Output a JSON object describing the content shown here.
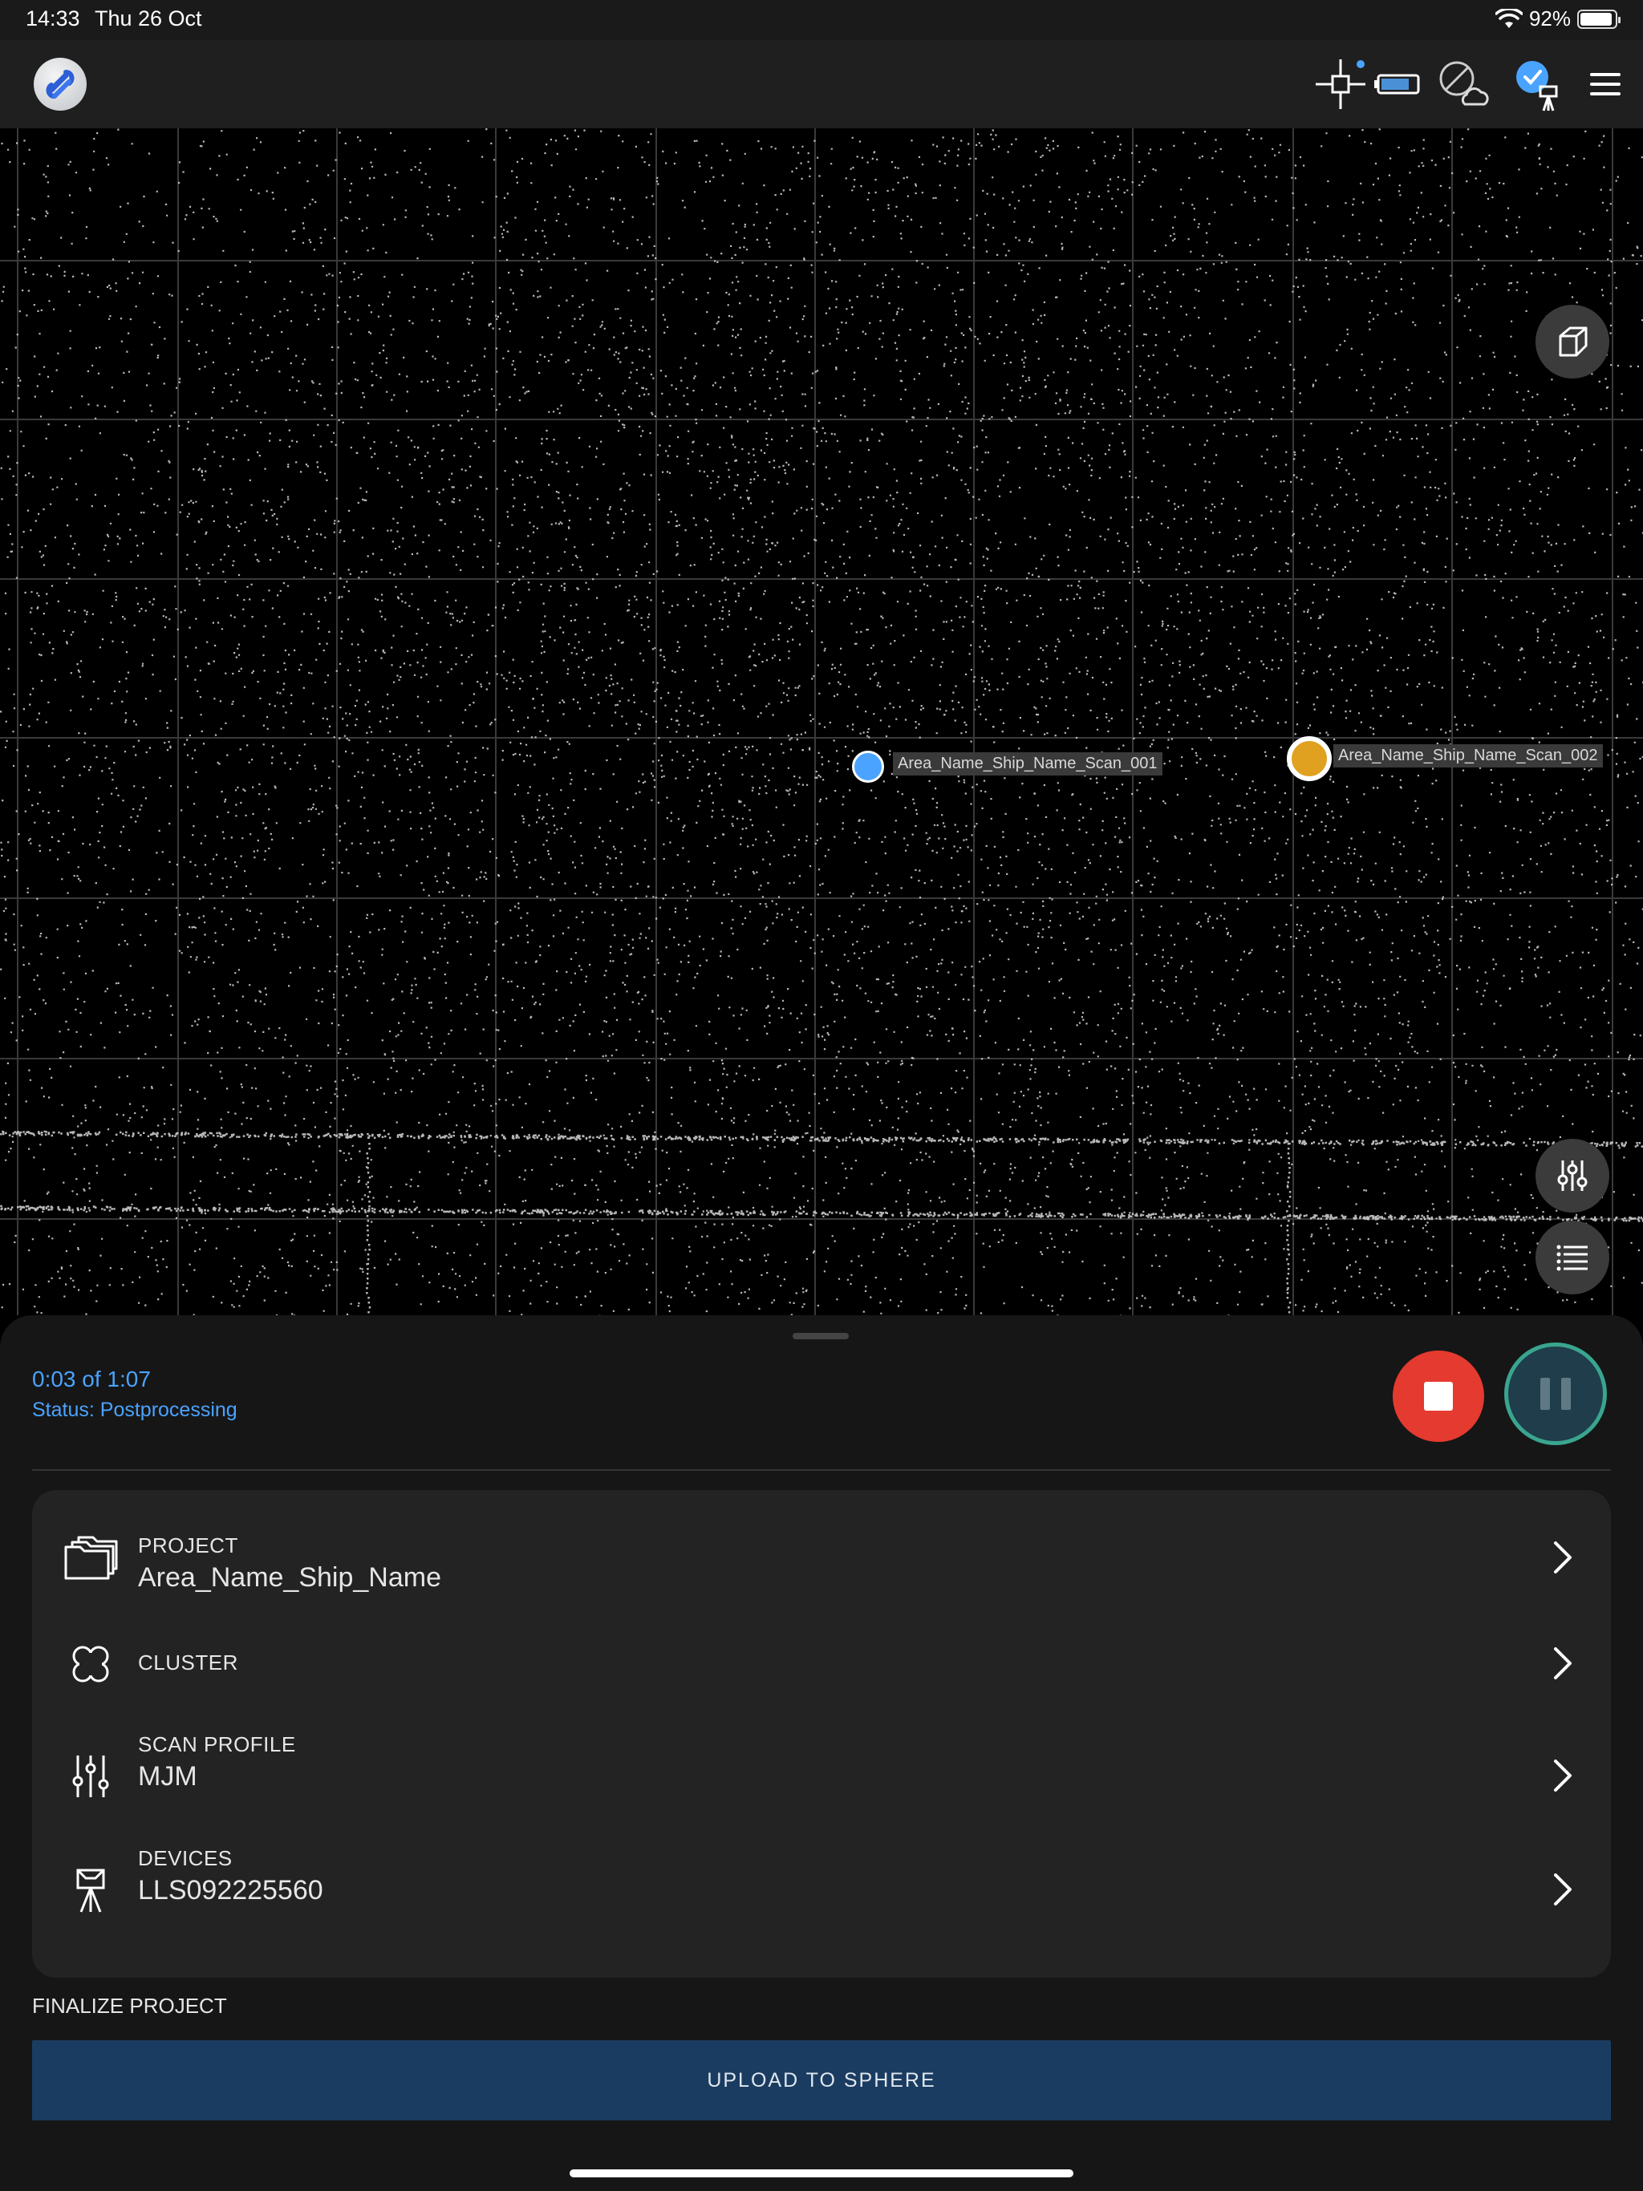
{
  "status_bar": {
    "time": "14:33",
    "date": "Thu 26 Oct",
    "battery": "92%",
    "battery_level": 0.92
  },
  "header": {
    "icons": [
      "app-logo-icon",
      "target-crosshair-icon",
      "battery-device-icon",
      "cloud-offline-icon",
      "scanner-connected-icon",
      "menu-icon"
    ]
  },
  "viewport": {
    "scans": [
      {
        "label": "Area_Name_Ship_Name_Scan_001",
        "color": "#4aa3ff"
      },
      {
        "label": "Area_Name_Ship_Name_Scan_002",
        "color": "#e0a020"
      }
    ],
    "buttons": [
      "3d-view-cube-icon",
      "filter-sliders-icon",
      "list-icon"
    ]
  },
  "scan_progress": {
    "time": "0:03 of 1:07",
    "status": "Status: Postprocessing"
  },
  "settings": {
    "project": {
      "title": "PROJECT",
      "value": "Area_Name_Ship_Name"
    },
    "cluster": {
      "title": "CLUSTER"
    },
    "scan_profile": {
      "title": "SCAN PROFILE",
      "value": "MJM"
    },
    "devices": {
      "title": "DEVICES",
      "value": "LLS092225560"
    }
  },
  "finalize": {
    "label": "FINALIZE PROJECT",
    "upload_button": "UPLOAD TO SPHERE"
  },
  "colors": {
    "accent": "#4aa3ff",
    "stop": "#e53a2f",
    "pause_ring": "#3aa58f",
    "upload": "#1b3c61"
  }
}
